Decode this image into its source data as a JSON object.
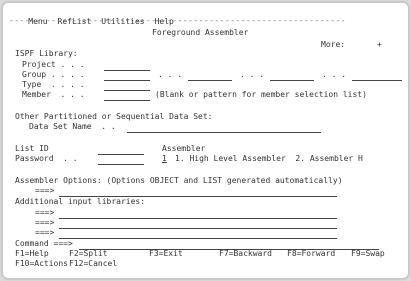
{
  "menu": [
    "Menu",
    "RefList",
    "Utilities",
    "Help"
  ],
  "separator": "----------------------------------------------------------------",
  "title": "Foreground Assembler",
  "more": "More:",
  "more_sign": "+",
  "ispf_library": {
    "heading": "ISPF Library:",
    "project": "Project . . .",
    "group": "Group . . . .",
    "group_sep1": ". . .",
    "group_sep2": ". . .",
    "group_sep3": ". . .",
    "type": "Type  . . . .",
    "member": "Member  . . .",
    "member_hint": "(Blank or pattern for member selection list)"
  },
  "other_dataset": {
    "heading": "Other Partitioned or Sequential Data Set:",
    "dsname": "Data Set Name  . ."
  },
  "list_id_label": "List ID",
  "password_label": "Password  . .",
  "assembler": {
    "label": "Assembler",
    "value": "1",
    "options": "1. High Level Assembler  2. Assembler H"
  },
  "assembler_options": "Assembler Options: (Options OBJECT and LIST generated automatically)",
  "arrow": "===>",
  "additional_libraries": "Additional input libraries:",
  "command_label": "Command ===>",
  "fkeys": [
    "F1=Help",
    "F2=Split",
    "F3=Exit",
    "F7=Backward",
    "F8=Forward",
    "F9=Swap"
  ],
  "fkeys_row2": [
    "F10=Actions",
    "F12=Cancel"
  ]
}
